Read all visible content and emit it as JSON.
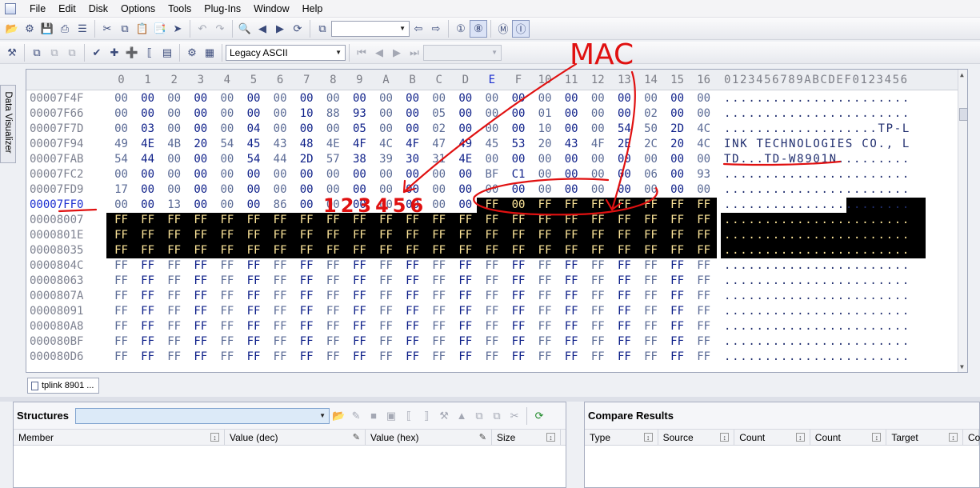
{
  "menu": [
    "File",
    "Edit",
    "Disk",
    "Options",
    "Tools",
    "Plug-Ins",
    "Window",
    "Help"
  ],
  "toolbar2": {
    "charset": "Legacy ASCII"
  },
  "side_tab": "Data Visualizer",
  "hex": {
    "column_labels": [
      "0",
      "1",
      "2",
      "3",
      "4",
      "5",
      "6",
      "7",
      "8",
      "9",
      "A",
      "B",
      "C",
      "D",
      "E",
      "F",
      "10",
      "11",
      "12",
      "13",
      "14",
      "15",
      "16"
    ],
    "ascii_header": "0123456789ABCDEF0123456",
    "rows": [
      {
        "addr": "00007F4F",
        "bytes": [
          "00",
          "00",
          "00",
          "00",
          "00",
          "00",
          "00",
          "00",
          "00",
          "00",
          "00",
          "00",
          "00",
          "00",
          "00",
          "00",
          "00",
          "00",
          "00",
          "00",
          "00",
          "00",
          "00"
        ],
        "ascii": ".......................",
        "sel_from": -1
      },
      {
        "addr": "00007F66",
        "bytes": [
          "00",
          "00",
          "00",
          "00",
          "00",
          "00",
          "00",
          "10",
          "88",
          "93",
          "00",
          "00",
          "05",
          "00",
          "00",
          "00",
          "01",
          "00",
          "00",
          "00",
          "02",
          "00",
          "00"
        ],
        "ascii": ".......................",
        "sel_from": -1
      },
      {
        "addr": "00007F7D",
        "bytes": [
          "00",
          "03",
          "00",
          "00",
          "00",
          "04",
          "00",
          "00",
          "00",
          "05",
          "00",
          "00",
          "02",
          "00",
          "00",
          "00",
          "10",
          "00",
          "00",
          "54",
          "50",
          "2D",
          "4C"
        ],
        "ascii": "...................TP-L",
        "sel_from": -1
      },
      {
        "addr": "00007F94",
        "bytes": [
          "49",
          "4E",
          "4B",
          "20",
          "54",
          "45",
          "43",
          "48",
          "4E",
          "4F",
          "4C",
          "4F",
          "47",
          "49",
          "45",
          "53",
          "20",
          "43",
          "4F",
          "2E",
          "2C",
          "20",
          "4C"
        ],
        "ascii": "INK TECHNOLOGIES CO., L",
        "sel_from": -1
      },
      {
        "addr": "00007FAB",
        "bytes": [
          "54",
          "44",
          "00",
          "00",
          "00",
          "54",
          "44",
          "2D",
          "57",
          "38",
          "39",
          "30",
          "31",
          "4E",
          "00",
          "00",
          "00",
          "00",
          "00",
          "00",
          "00",
          "00",
          "00"
        ],
        "ascii": "TD...TD-W8901N.........",
        "sel_from": -1
      },
      {
        "addr": "00007FC2",
        "bytes": [
          "00",
          "00",
          "00",
          "00",
          "00",
          "00",
          "00",
          "00",
          "00",
          "00",
          "00",
          "00",
          "00",
          "00",
          "BF",
          "C1",
          "00",
          "00",
          "00",
          "00",
          "06",
          "00",
          "93"
        ],
        "ascii": ".......................",
        "sel_from": -1
      },
      {
        "addr": "00007FD9",
        "bytes": [
          "17",
          "00",
          "00",
          "00",
          "00",
          "00",
          "00",
          "00",
          "00",
          "00",
          "00",
          "00",
          "00",
          "00",
          "00",
          "00",
          "00",
          "00",
          "00",
          "00",
          "00",
          "00",
          "00"
        ],
        "ascii": ".......................",
        "sel_from": -1
      },
      {
        "addr": "00007FF0",
        "bytes": [
          "00",
          "00",
          "13",
          "00",
          "00",
          "00",
          "86",
          "00",
          "00",
          "00",
          "00",
          "00",
          "00",
          "00",
          "FF",
          "00",
          "FF",
          "FF",
          "FF",
          "FF",
          "FF",
          "FF",
          "FF"
        ],
        "ascii": ".......................",
        "sel_from": 14
      },
      {
        "addr": "00008007",
        "bytes": [
          "FF",
          "FF",
          "FF",
          "FF",
          "FF",
          "FF",
          "FF",
          "FF",
          "FF",
          "FF",
          "FF",
          "FF",
          "FF",
          "FF",
          "FF",
          "FF",
          "FF",
          "FF",
          "FF",
          "FF",
          "FF",
          "FF",
          "FF"
        ],
        "ascii": ".......................",
        "sel_from": 0
      },
      {
        "addr": "0000801E",
        "bytes": [
          "FF",
          "FF",
          "FF",
          "FF",
          "FF",
          "FF",
          "FF",
          "FF",
          "FF",
          "FF",
          "FF",
          "FF",
          "FF",
          "FF",
          "FF",
          "FF",
          "FF",
          "FF",
          "FF",
          "FF",
          "FF",
          "FF",
          "FF"
        ],
        "ascii": ".......................",
        "sel_from": 0
      },
      {
        "addr": "00008035",
        "bytes": [
          "FF",
          "FF",
          "FF",
          "FF",
          "FF",
          "FF",
          "FF",
          "FF",
          "FF",
          "FF",
          "FF",
          "FF",
          "FF",
          "FF",
          "FF",
          "FF",
          "FF",
          "FF",
          "FF",
          "FF",
          "FF",
          "FF",
          "FF"
        ],
        "ascii": ".......................",
        "sel_from": 0
      },
      {
        "addr": "0000804C",
        "bytes": [
          "FF",
          "FF",
          "FF",
          "FF",
          "FF",
          "FF",
          "FF",
          "FF",
          "FF",
          "FF",
          "FF",
          "FF",
          "FF",
          "FF",
          "FF",
          "FF",
          "FF",
          "FF",
          "FF",
          "FF",
          "FF",
          "FF",
          "FF"
        ],
        "ascii": ".......................",
        "sel_from": -1
      },
      {
        "addr": "00008063",
        "bytes": [
          "FF",
          "FF",
          "FF",
          "FF",
          "FF",
          "FF",
          "FF",
          "FF",
          "FF",
          "FF",
          "FF",
          "FF",
          "FF",
          "FF",
          "FF",
          "FF",
          "FF",
          "FF",
          "FF",
          "FF",
          "FF",
          "FF",
          "FF"
        ],
        "ascii": ".......................",
        "sel_from": -1
      },
      {
        "addr": "0000807A",
        "bytes": [
          "FF",
          "FF",
          "FF",
          "FF",
          "FF",
          "FF",
          "FF",
          "FF",
          "FF",
          "FF",
          "FF",
          "FF",
          "FF",
          "FF",
          "FF",
          "FF",
          "FF",
          "FF",
          "FF",
          "FF",
          "FF",
          "FF",
          "FF"
        ],
        "ascii": ".......................",
        "sel_from": -1
      },
      {
        "addr": "00008091",
        "bytes": [
          "FF",
          "FF",
          "FF",
          "FF",
          "FF",
          "FF",
          "FF",
          "FF",
          "FF",
          "FF",
          "FF",
          "FF",
          "FF",
          "FF",
          "FF",
          "FF",
          "FF",
          "FF",
          "FF",
          "FF",
          "FF",
          "FF",
          "FF"
        ],
        "ascii": ".......................",
        "sel_from": -1
      },
      {
        "addr": "000080A8",
        "bytes": [
          "FF",
          "FF",
          "FF",
          "FF",
          "FF",
          "FF",
          "FF",
          "FF",
          "FF",
          "FF",
          "FF",
          "FF",
          "FF",
          "FF",
          "FF",
          "FF",
          "FF",
          "FF",
          "FF",
          "FF",
          "FF",
          "FF",
          "FF"
        ],
        "ascii": ".......................",
        "sel_from": -1
      },
      {
        "addr": "000080BF",
        "bytes": [
          "FF",
          "FF",
          "FF",
          "FF",
          "FF",
          "FF",
          "FF",
          "FF",
          "FF",
          "FF",
          "FF",
          "FF",
          "FF",
          "FF",
          "FF",
          "FF",
          "FF",
          "FF",
          "FF",
          "FF",
          "FF",
          "FF",
          "FF"
        ],
        "ascii": ".......................",
        "sel_from": -1
      },
      {
        "addr": "000080D6",
        "bytes": [
          "FF",
          "FF",
          "FF",
          "FF",
          "FF",
          "FF",
          "FF",
          "FF",
          "FF",
          "FF",
          "FF",
          "FF",
          "FF",
          "FF",
          "FF",
          "FF",
          "FF",
          "FF",
          "FF",
          "FF",
          "FF",
          "FF",
          "FF"
        ],
        "ascii": ".......................",
        "sel_from": -1
      }
    ],
    "current_address": "00007FF0",
    "current_column": "E"
  },
  "document_tab": "tplink 8901 ...",
  "structures": {
    "title": "Structures",
    "columns": [
      "Member",
      "Value (dec)",
      "Value (hex)",
      "Size"
    ]
  },
  "compare": {
    "title": "Compare Results",
    "columns": [
      "Type",
      "Source",
      "Count",
      "Count",
      "Target",
      "Co"
    ]
  },
  "annotation": {
    "label": "MAC",
    "digits": "123456",
    "color": "#e01010"
  }
}
